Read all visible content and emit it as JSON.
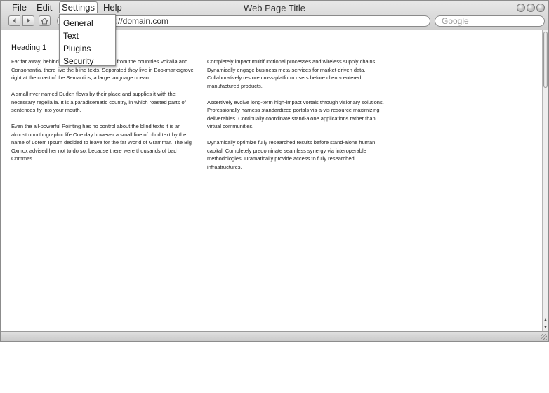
{
  "window": {
    "title": "Web Page Title"
  },
  "menubar": {
    "items": [
      {
        "label": "File"
      },
      {
        "label": "Edit"
      },
      {
        "label": "Settings"
      },
      {
        "label": "Help"
      }
    ]
  },
  "settings_menu": {
    "items": [
      {
        "label": "General"
      },
      {
        "label": "Text"
      },
      {
        "label": "Plugins"
      },
      {
        "label": "Security"
      }
    ]
  },
  "toolbar": {
    "address_value": "p://domain.com",
    "search_placeholder": "Google"
  },
  "page": {
    "heading": "Heading 1",
    "left_column": [
      "Far far away, behind the word mountains, far from the countries Vokalia and Consonantia, there live the blind texts. Separated they live in Bookmarksgrove right at the coast of the Semantics, a large language ocean.",
      "A small river named Duden flows by their place and supplies it with the necessary regelialia. It is a paradisematic country, in which roasted parts of sentences fly into your mouth.",
      "Even the all-powerful Pointing has no control about the blind texts it is an almost unorthographic life One day however a small line of blind text by the name of Lorem Ipsum decided to leave for the far World of Grammar. The Big Oxmox advised her not to do so, because there were thousands of bad Commas."
    ],
    "right_column": [
      "Completely impact multifunctional processes and wireless supply chains. Dynamically engage business meta-services for market-driven data. Collaboratively restore cross-platform users before client-centered manufactured products.",
      "Assertively evolve long-term high-impact vortals through visionary solutions. Professionally harness standardized portals vis-a-vis resource maximizing deliverables. Continually coordinate stand-alone applications rather than virtual communities.",
      "Dynamically optimize fully researched results before stand-alone human capital. Completely predominate seamless synergy via interoperable methodologies. Dramatically provide access to fully researched infrastructures."
    ]
  },
  "icons": {
    "back": "back-arrow-icon",
    "forward": "forward-arrow-icon",
    "home": "home-icon",
    "window_controls": [
      "window-control-icon",
      "window-control-icon",
      "window-control-icon"
    ]
  },
  "colors": {
    "chrome_top": "#e8e8e8",
    "chrome_bottom": "#cfcfcf",
    "border": "#8a8a8a"
  }
}
